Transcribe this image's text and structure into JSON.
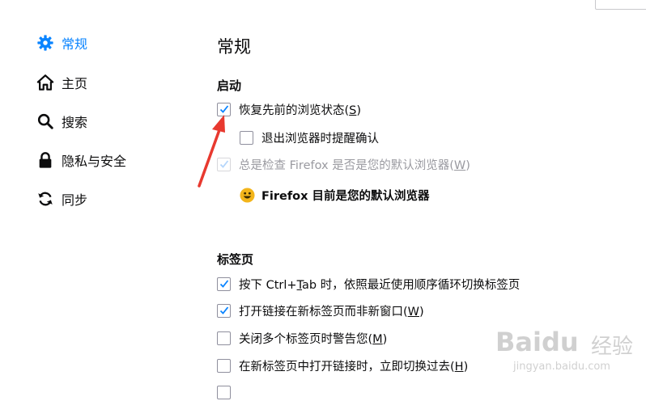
{
  "sidebar": {
    "items": [
      {
        "label": "常规",
        "icon": "gear-icon",
        "active": true
      },
      {
        "label": "主页",
        "icon": "home-icon"
      },
      {
        "label": "搜索",
        "icon": "search-icon"
      },
      {
        "label": "隐私与安全",
        "icon": "lock-icon"
      },
      {
        "label": "同步",
        "icon": "sync-icon"
      }
    ]
  },
  "main": {
    "title": "常规",
    "startup": {
      "heading": "启动",
      "restore_session": {
        "label": "恢复先前的浏览状态(",
        "key": "S",
        "suffix": ")",
        "checked": true
      },
      "warn_on_quit": {
        "label": "退出浏览器时提醒确认",
        "checked": false
      },
      "check_default": {
        "label": "总是检查 Firefox 是否是您的默认浏览器(",
        "key": "W",
        "suffix": ")",
        "checked": true,
        "disabled": true
      },
      "default_status": "Firefox 目前是您的默认浏览器"
    },
    "tabs": {
      "heading": "标签页",
      "items": [
        {
          "prefix": "按下 Ctrl+",
          "key": "T",
          "label": "ab 时，依照最近使用顺序循环切换标签页",
          "suffix": "",
          "checked": true
        },
        {
          "prefix": "",
          "label": "打开链接在新标签页而非新窗口(",
          "key": "W",
          "suffix": ")",
          "checked": true
        },
        {
          "prefix": "",
          "label": "关闭多个标签页时警告您(",
          "key": "M",
          "suffix": ")",
          "checked": false
        },
        {
          "prefix": "",
          "label": "在新标签页中打开链接时，立即切换过去(",
          "key": "H",
          "suffix": ")",
          "checked": false
        }
      ]
    }
  },
  "watermark": {
    "logo": "Baidu",
    "cn": "经验",
    "url": "jingyan.baidu.com"
  },
  "colors": {
    "accent": "#0a84ff",
    "arrow": "#e8392f",
    "text": "#0c0c0d"
  }
}
